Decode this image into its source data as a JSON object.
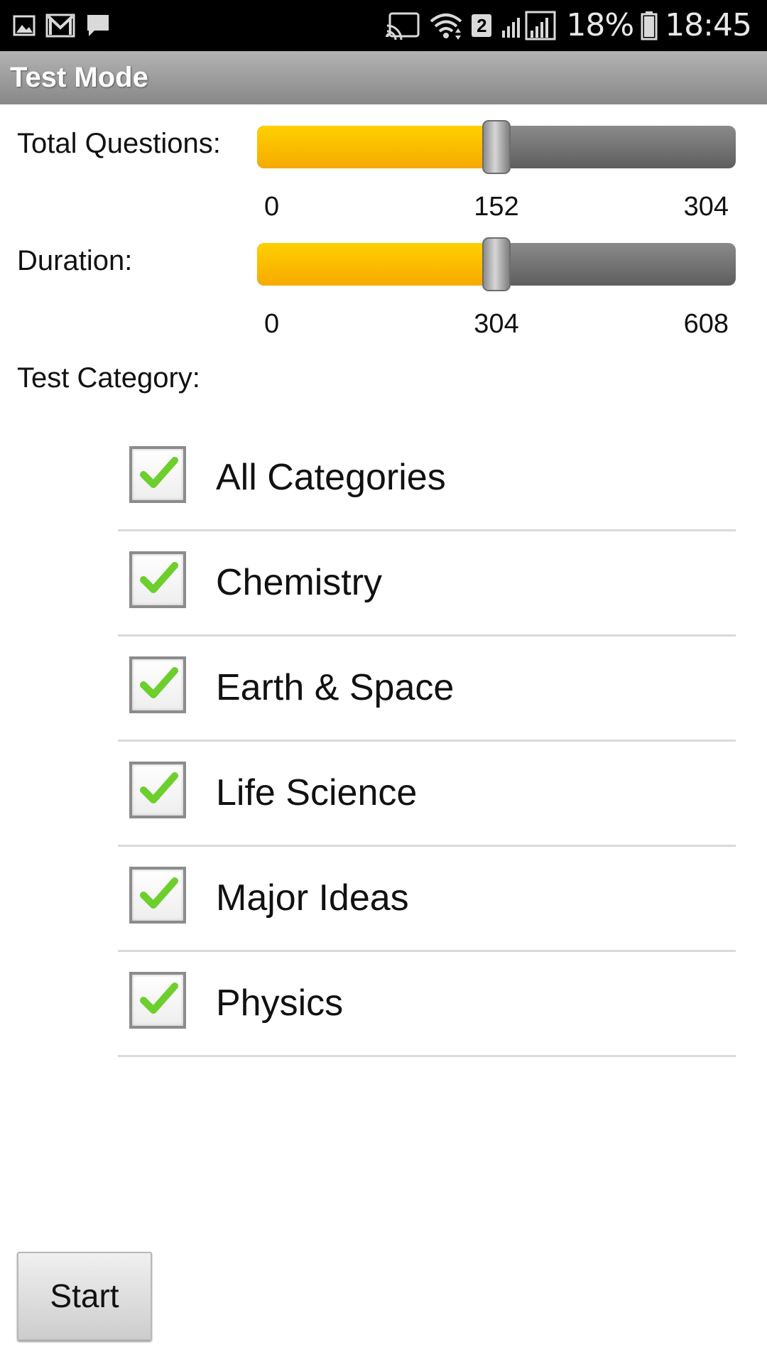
{
  "status_bar": {
    "left_icons": [
      "image-icon",
      "gmail-icon",
      "message-icon"
    ],
    "right_icons": [
      "cast-icon",
      "wifi-icon",
      "sim-signal-icon"
    ],
    "sim_number": "2",
    "battery_percent": "18%",
    "time": "18:45"
  },
  "title_bar": {
    "title": "Test Mode"
  },
  "total_questions": {
    "label": "Total Questions:",
    "min": "0",
    "mid": "152",
    "max": "304",
    "value_fraction": 0.5
  },
  "duration": {
    "label": "Duration:",
    "min": "0",
    "mid": "304",
    "max": "608",
    "value_fraction": 0.5
  },
  "test_category": {
    "label": "Test Category:",
    "items": [
      {
        "label": "All Categories",
        "checked": true
      },
      {
        "label": "Chemistry",
        "checked": true
      },
      {
        "label": "Earth & Space",
        "checked": true
      },
      {
        "label": "Life Science",
        "checked": true
      },
      {
        "label": "Major Ideas",
        "checked": true
      },
      {
        "label": "Physics",
        "checked": true
      }
    ]
  },
  "start_button": {
    "label": "Start"
  },
  "colors": {
    "slider_fill": "#ffc000",
    "slider_track": "#6e6e6e",
    "checkmark": "#6ccf2c",
    "title_bar": "#9e9e9e"
  }
}
